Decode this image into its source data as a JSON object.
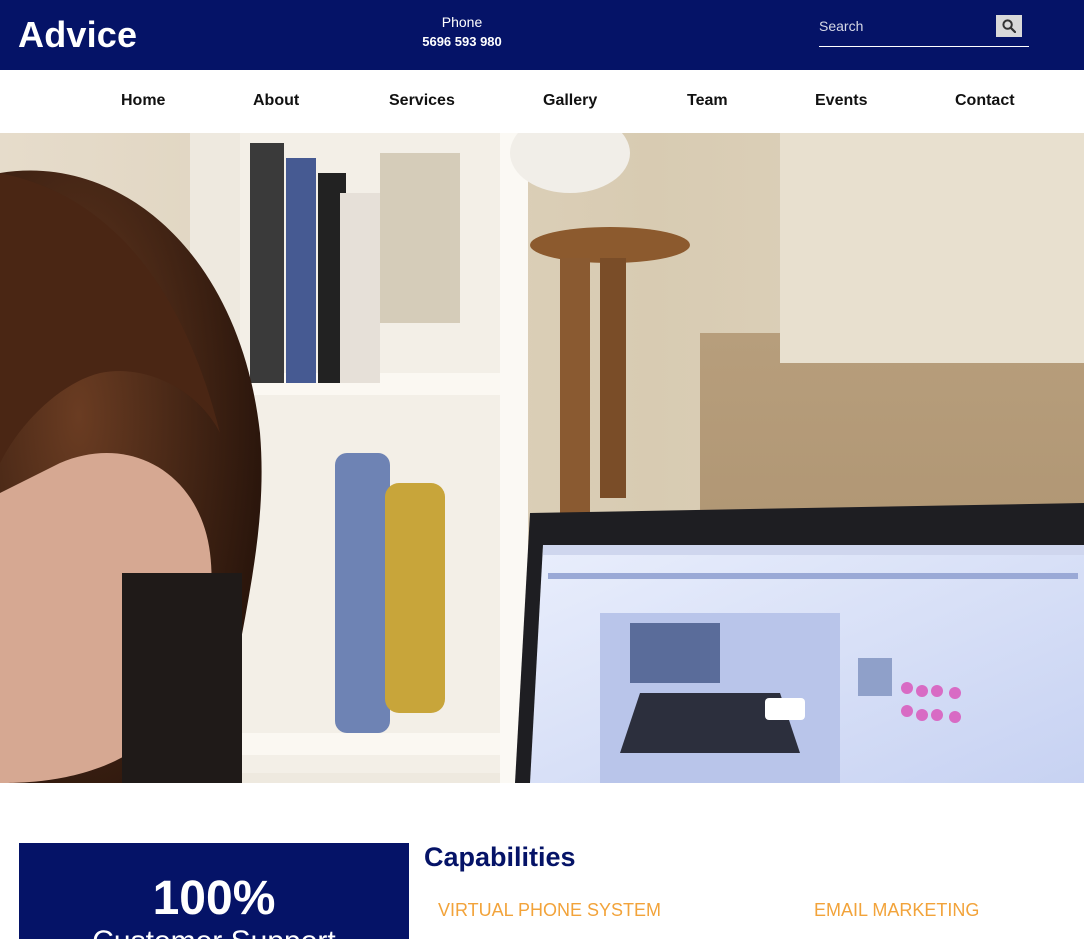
{
  "header": {
    "logo": "Advice",
    "phone_label": "Phone",
    "phone_number": "5696 593 980",
    "search_placeholder": "Search"
  },
  "nav": {
    "items": [
      {
        "label": "Home"
      },
      {
        "label": "About"
      },
      {
        "label": "Services"
      },
      {
        "label": "Gallery"
      },
      {
        "label": "Team"
      },
      {
        "label": "Events"
      },
      {
        "label": "Contact"
      }
    ]
  },
  "stat": {
    "value": "100%",
    "label": "Customer Support"
  },
  "capabilities": {
    "title": "Capabilities",
    "items": [
      {
        "label": "VIRTUAL PHONE SYSTEM"
      },
      {
        "label": "EMAIL MARKETING"
      }
    ]
  },
  "colors": {
    "primary": "#051367",
    "accent": "#f2a33a"
  }
}
